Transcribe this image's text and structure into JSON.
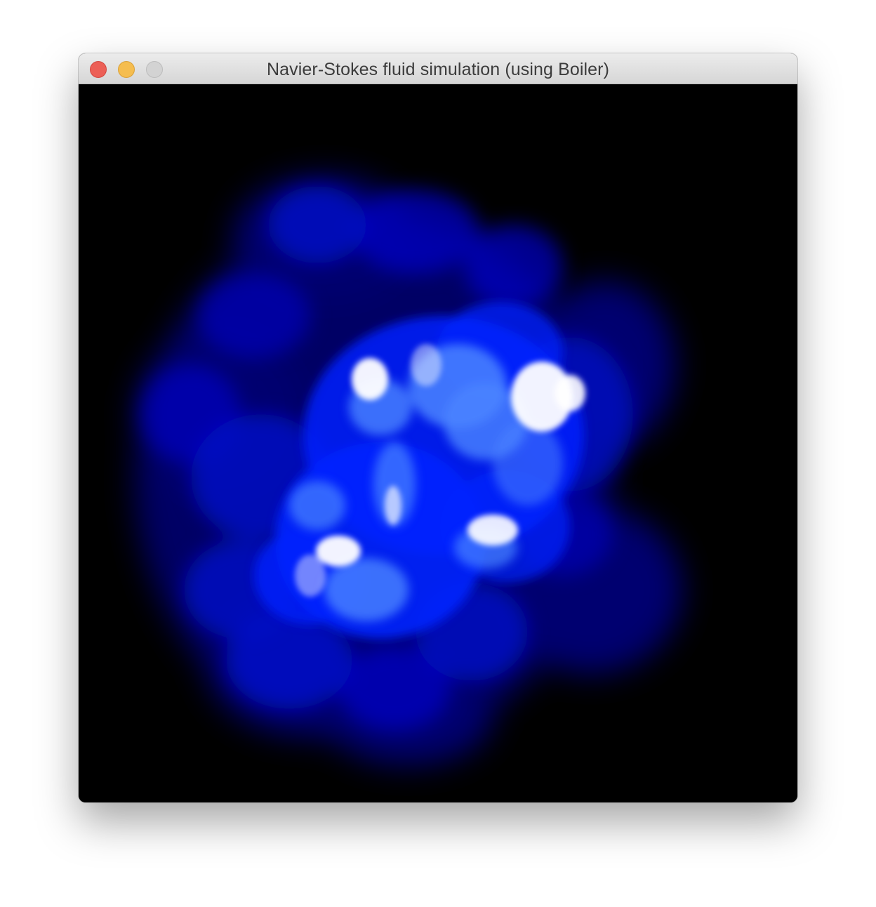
{
  "window": {
    "title": "Navier-Stokes fluid simulation (using Boiler)"
  },
  "controls": {
    "close": "close-button",
    "minimize": "minimize-button",
    "zoom": "zoom-button"
  },
  "colors": {
    "close": "#ec5f56",
    "minimize": "#f5bd4f",
    "zoom_disabled": "#d3d3d3",
    "background": "#000000",
    "fluid_dark": "#00007a",
    "fluid_mid": "#0018e6",
    "fluid_bright": "#4f8cff",
    "fluid_core": "#ffffff"
  }
}
